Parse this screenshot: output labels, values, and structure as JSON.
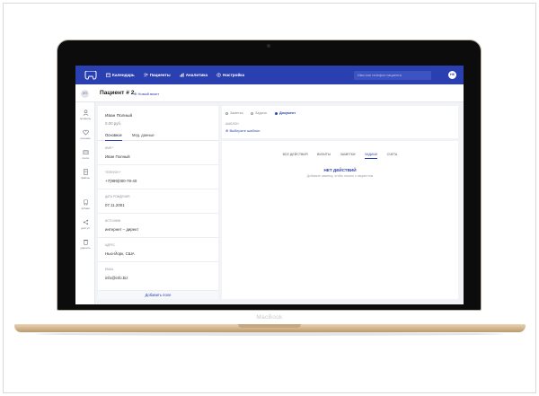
{
  "device": {
    "label": "MacBook"
  },
  "colors": {
    "brand": "#2a3fb0",
    "background": "#f2f3f7"
  },
  "nav": {
    "items": [
      {
        "icon": "calendar-icon",
        "label": "Календарь"
      },
      {
        "icon": "patients-icon",
        "label": "Пациенты"
      },
      {
        "icon": "analytics-icon",
        "label": "Аналитика"
      },
      {
        "icon": "settings-icon",
        "label": "Настройка"
      }
    ],
    "search_placeholder": "Имя или телефон пациента",
    "user_initials": "НК"
  },
  "patient": {
    "initials": "ИП",
    "title": "Пациент # 2",
    "new_visit_label": "Новый визит",
    "name": "Иван Полный",
    "balance": "0.00 руб."
  },
  "sidebar": {
    "items": [
      {
        "icon": "person-icon",
        "label": "профиль"
      },
      {
        "icon": "heart-icon",
        "label": "лечение"
      },
      {
        "icon": "bill-icon",
        "label": "счета"
      },
      {
        "icon": "file-icon",
        "label": "файлы"
      },
      {
        "icon": "tooth-icon",
        "label": "зубная"
      },
      {
        "icon": "share-icon",
        "label": "доступ"
      },
      {
        "icon": "trash-icon",
        "label": "удалить"
      }
    ]
  },
  "card": {
    "tabs": [
      "Основное",
      "Мед. данные"
    ],
    "fields": [
      {
        "label": "Имя *",
        "value": "Иван Полный"
      },
      {
        "label": "Телефон *",
        "value": "+7(999)000-78-40"
      },
      {
        "label": "Дата рождения",
        "value": "07.11.2001"
      },
      {
        "label": "Источник",
        "value": "интернет – директ"
      },
      {
        "label": "Адрес",
        "value": "Нью-Йорк, США"
      },
      {
        "label": "Email",
        "value": "info@info.biz"
      }
    ],
    "add_field_label": "Добавить поле"
  },
  "composer": {
    "types": [
      "Заметка",
      "Задача",
      "Документ"
    ],
    "active_type": "Документ",
    "template_label": "Шаблон",
    "choose_template_label": "Выберите шаблон"
  },
  "feed": {
    "filters": [
      "Все действия",
      "Визиты",
      "Заметки",
      "Задачи",
      "Счета"
    ],
    "active_filter": "Задачи",
    "empty_title": "Нет действий",
    "empty_subtitle": "Добавьте заметку, чтобы начать с пациентом"
  }
}
